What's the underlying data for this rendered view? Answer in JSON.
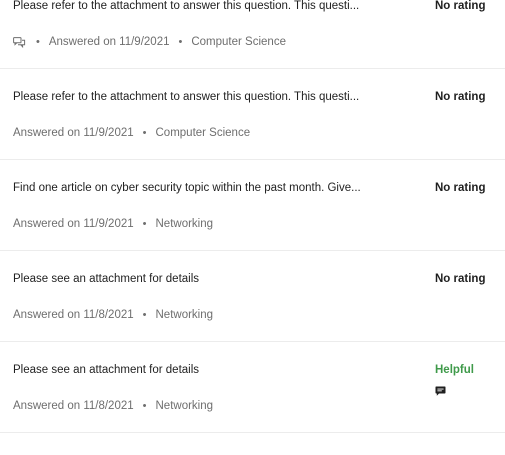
{
  "questions": [
    {
      "title": "Please refer to the attachment to answer this question. This questi...",
      "has_chat_icon": true,
      "answered": "Answered on 11/9/2021",
      "category": "Computer Science",
      "rating": "No rating",
      "has_comment_icon": false,
      "chat_icon": "chat-bubbles-icon"
    },
    {
      "title": "Please refer to the attachment to answer this question. This questi...",
      "has_chat_icon": false,
      "answered": "Answered on 11/9/2021",
      "category": "Computer Science",
      "rating": "No rating",
      "has_comment_icon": false
    },
    {
      "title": "Find one article on cyber security topic within the past month. Give...",
      "has_chat_icon": false,
      "answered": "Answered on 11/9/2021",
      "category": "Networking",
      "rating": "No rating",
      "has_comment_icon": false
    },
    {
      "title": "Please see an attachment for details",
      "has_chat_icon": false,
      "answered": "Answered on 11/8/2021",
      "category": "Networking",
      "rating": "No rating",
      "has_comment_icon": false
    },
    {
      "title": "Please see an attachment for details",
      "has_chat_icon": false,
      "answered": "Answered on 11/8/2021",
      "category": "Networking",
      "rating": "Helpful",
      "has_comment_icon": true,
      "comment_icon": "comment-icon"
    }
  ],
  "colors": {
    "text": "#1f1f1f",
    "meta": "#6e6e6e",
    "helpful": "#3f9a4a",
    "divider": "#ececec"
  }
}
